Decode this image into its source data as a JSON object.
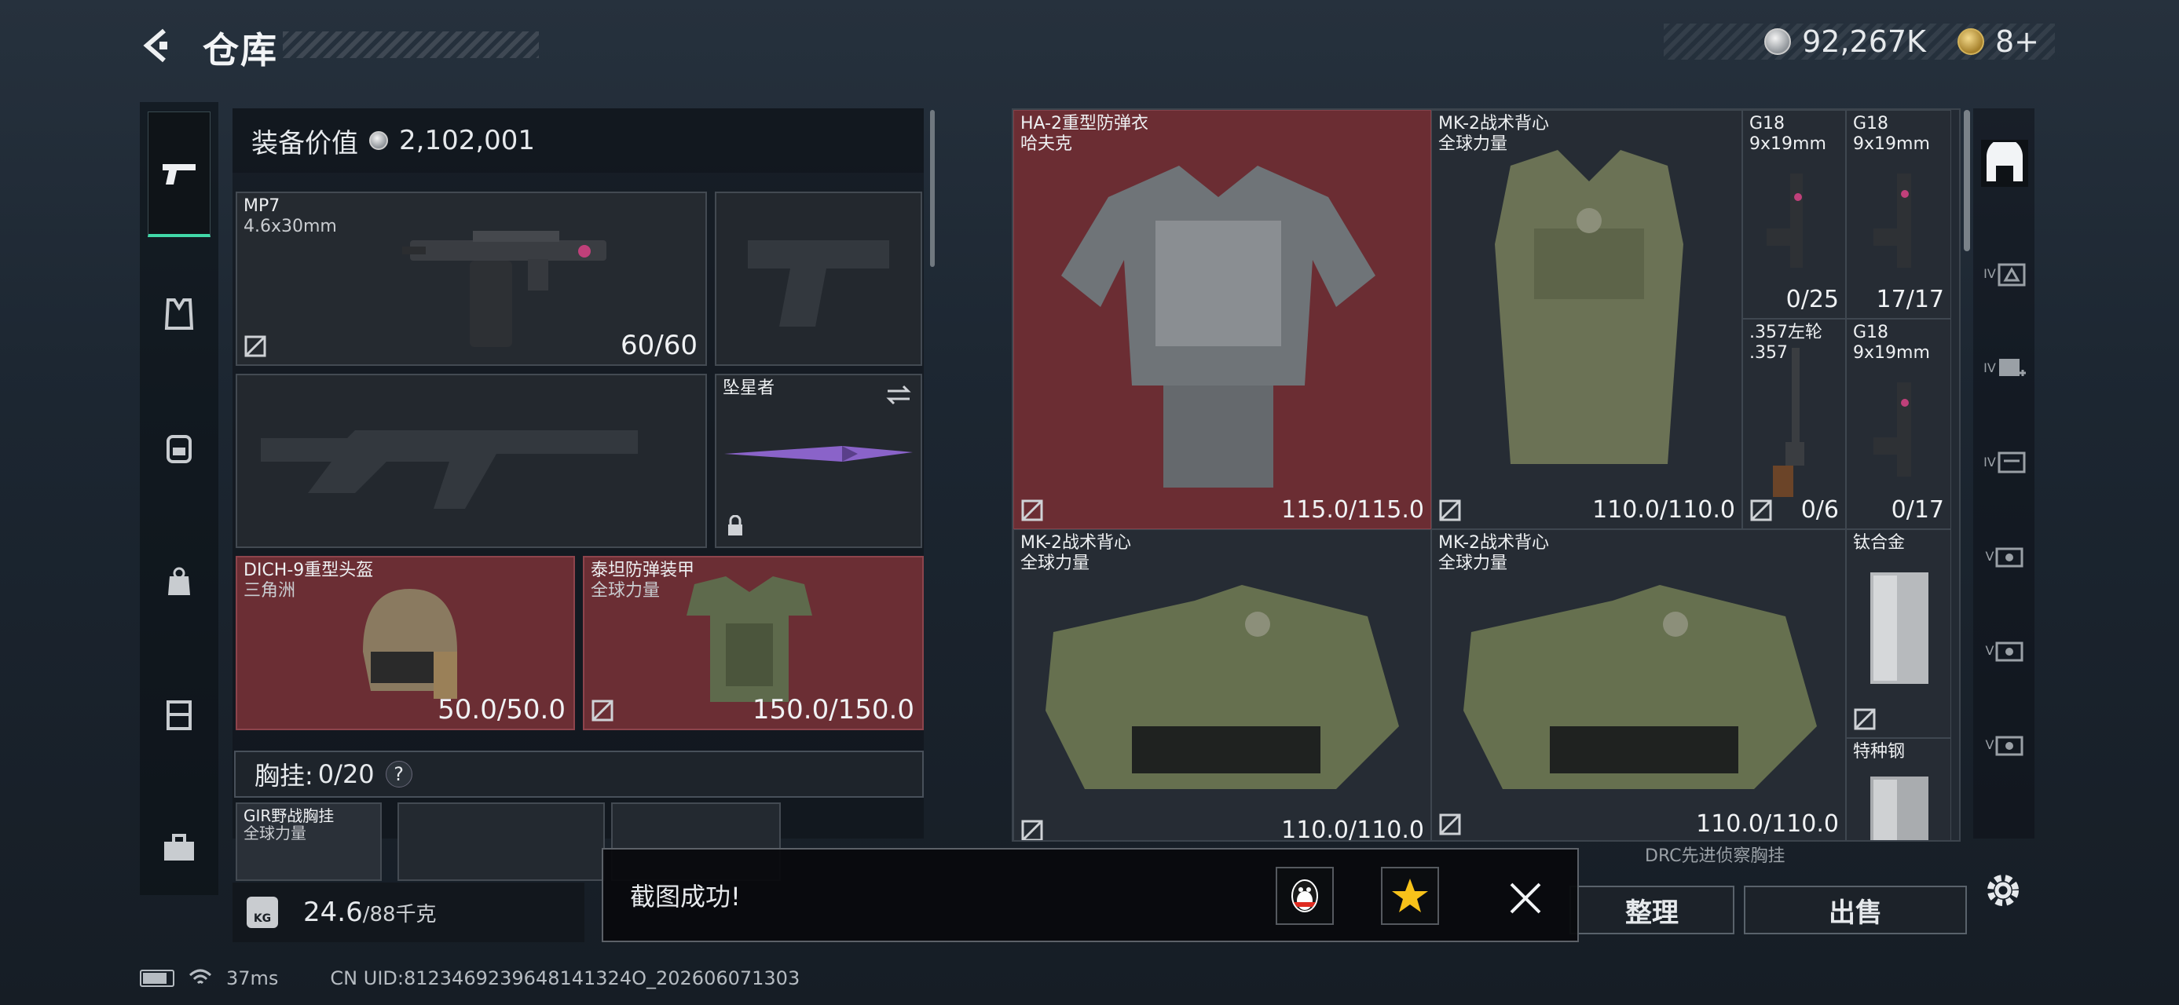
{
  "header": {
    "title": "仓库"
  },
  "currency": {
    "silver": "92,267K",
    "gold": "8+"
  },
  "left_nav": {
    "items": [
      "weapons",
      "armor",
      "backpack",
      "bag",
      "container",
      "case"
    ]
  },
  "equipment": {
    "value_label": "装备价值",
    "value": "2,102,001",
    "primary": {
      "name": "MP7",
      "ammo": "4.6x30mm",
      "durability": "60/60"
    },
    "secondary": {
      "name": ""
    },
    "melee": {
      "name": "坠星者"
    },
    "helmet": {
      "name": "DICH-9重型头盔",
      "origin": "三角洲",
      "durability": "50.0/50.0"
    },
    "armor": {
      "name": "泰坦防弹装甲",
      "origin": "全球力量",
      "durability": "150.0/150.0"
    },
    "chest_label": "胸挂:",
    "chest_count": "0/20",
    "chest_help": "?",
    "chest_item": {
      "name": "GIR野战胸挂",
      "origin": "全球力量"
    }
  },
  "weight": {
    "current": "24.6",
    "max": "/88千克",
    "icon_label": "KG"
  },
  "grid": [
    {
      "name": "HA-2重型防弹衣",
      "origin": "哈夫克",
      "durability": "115.0/115.0"
    },
    {
      "name": "MK-2战术背心",
      "origin": "全球力量",
      "durability": "110.0/110.0"
    },
    {
      "name": "G18",
      "origin": "9x19mm",
      "durability": "0/25"
    },
    {
      "name": "G18",
      "origin": "9x19mm",
      "durability": "17/17"
    },
    {
      "name": ".357左轮",
      "origin": ".357",
      "durability": "0/6"
    },
    {
      "name": "G18",
      "origin": "9x19mm",
      "durability": "0/17"
    },
    {
      "name": "MK-2战术背心",
      "origin": "全球力量",
      "durability": "110.0/110.0"
    },
    {
      "name": "MK-2战术背心",
      "origin": "全球力量",
      "durability": "110.0/110.0"
    },
    {
      "name": "钛合金",
      "origin": "",
      "durability": ""
    },
    {
      "name": "特种钢",
      "origin": "",
      "durability": ""
    },
    {
      "name": "DRC先进侦察胸挂",
      "origin": "",
      "durability": ""
    }
  ],
  "right_tabs": {
    "labels": [
      "IV",
      "IV",
      "IV",
      "V",
      "V",
      "V"
    ]
  },
  "buttons": {
    "sort": "整理",
    "sell": "出售"
  },
  "toast": {
    "message": "截图成功!"
  },
  "status": {
    "ping": "37ms",
    "uid": "CN UID:8123469239648141324O_202606071303"
  },
  "colors": {
    "accent": "#41d9a8",
    "rare_bg": "#6b2d33"
  }
}
